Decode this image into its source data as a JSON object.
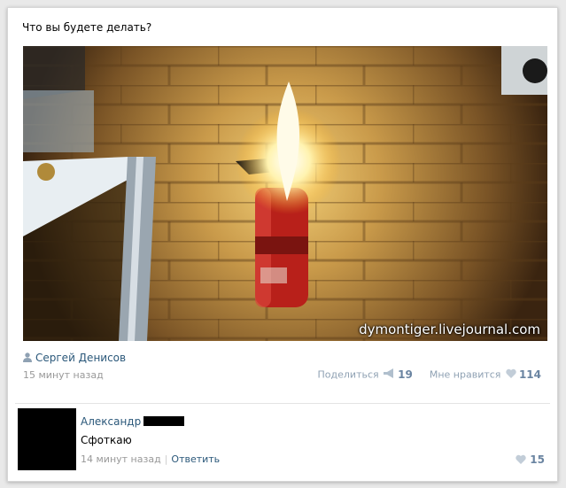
{
  "post": {
    "text": "Что вы будете делать?",
    "watermark": "dymontiger.livejournal.com",
    "author": "Сергей Денисов",
    "time": "15 минут назад",
    "share_label": "Поделиться",
    "share_count": "19",
    "like_label": "Мне нравится",
    "like_count": "114"
  },
  "comment": {
    "author": "Александр",
    "text": "Сфоткаю",
    "time": "14 минут назад",
    "separator": "|",
    "reply_label": "Ответить",
    "like_count": "15"
  },
  "colors": {
    "link": "#2b587a",
    "muted": "#999999",
    "action": "#8fa1b3"
  },
  "icons": [
    "person-icon",
    "megaphone-icon",
    "heart-icon"
  ]
}
